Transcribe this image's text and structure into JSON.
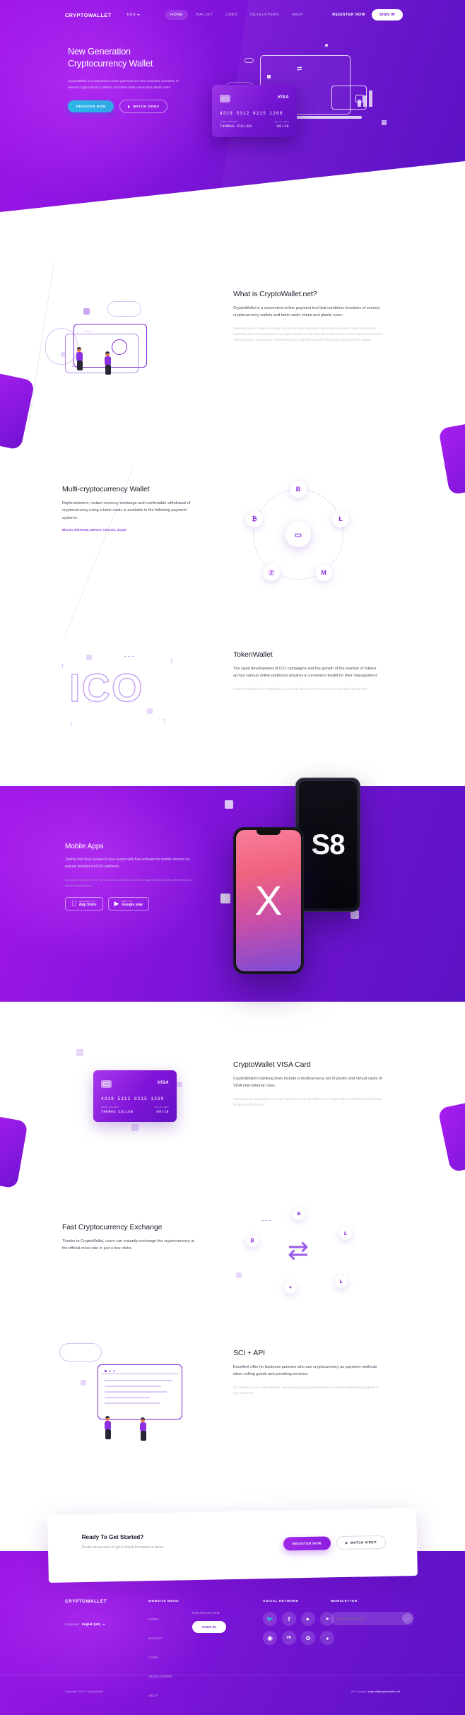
{
  "header": {
    "brand": "CRYPTOWALLET",
    "language": "ENG",
    "nav": [
      {
        "label": "HOME",
        "active": true
      },
      {
        "label": "WALLET",
        "active": false
      },
      {
        "label": "CARD",
        "active": false
      },
      {
        "label": "DEVELOPERS",
        "active": false
      },
      {
        "label": "HELP",
        "active": false
      }
    ],
    "register_label": "REGISTER NOW",
    "signin_label": "SIGN IN"
  },
  "hero": {
    "title_line1": "New Generation",
    "title_line2": "Cryptocurrency Wallet",
    "paragraph": "CryptoWallet is a convenient online payment tool that combines functions of several cryptocurrency wallets and bank cards virtual and plastic ones",
    "primary_button": "REGISTER NOW",
    "secondary_button": "WATCH VIDEO",
    "card": {
      "brand": "VISA",
      "number": "4319  5312  0215  1269",
      "holder_label": "CARD HOLDER",
      "holder_name": "THOMAS CULLEN",
      "expiry_label": "VALID THRU",
      "expiry": "09/18"
    }
  },
  "sections": {
    "what_is": {
      "title": "What is CryptoWallet.net?",
      "paragraph": "CryptoWallet is a convenient online payment tool that combines functions of several cryptocurrency wallets and bank cards virtual and plastic ones.",
      "fine_print": "Absolutely free of charge you can get an address of the interesting cryptocurrency, the list of which is constantly expanding with the development of our payment platform, and associate to your account a VISA international card for online payments, use at points of merchant service and withdrawal of funds through the global ATM network."
    },
    "multi_wallet": {
      "title": "Multi-cryptocurrency Wallet",
      "paragraph": "Replenishment, instant currency exchange and comfortable withdrawal of cryptocurrency using a bank cards is available in the following payment systems:",
      "coins_line": "Bitcoin, Ethereum, Monero, Litecoin, ZCash",
      "coin_symbols": [
        "₿",
        "Ł",
        "Ƀ",
        "M",
        "♦"
      ]
    },
    "token_wallet": {
      "title": "TokenWallet",
      "paragraph": "The rapid development of ICO campaigns and the growth of the number of tokens across various online platforms requires a convenient toolkit for their management.",
      "fine_print": "Using the capabilities of CryptoWallet, you can add any tokens into your account and easily operate them.",
      "art_word": "ICO"
    },
    "mobile_apps": {
      "title": "Mobile Apps",
      "paragraph": "Twenty-four hour access to your assets with free software for mobile devices on popular Android and iOS platforms.",
      "fine_print": "A complete replacement of the web version, which has the necessary functionality for performing any financial transactions.",
      "stores": [
        {
          "sub": "Download on the",
          "main": "App Store",
          "icon": "apple-icon"
        },
        {
          "sub": "GET IT ON",
          "main": "Google play",
          "icon": "google-play-icon"
        }
      ],
      "phone_x_label": "X",
      "phone_s8_label": "S8"
    },
    "visa_card": {
      "title": "CryptoWallet VISA Card",
      "paragraph": "CryptoWallet's banking tools include a multicurrency set of plastic and virtual cards of VISA international class.",
      "fine_print": "That allows you to instantly convert the cryptocurrency to pay online, use in shops outlet and withdraw funds through the global ATM network.",
      "card": {
        "brand": "VISA",
        "number": "4319  5312  0215  1269",
        "holder_label": "CARD HOLDER",
        "holder_name": "THOMAS CULLEN",
        "expiry_label": "VALID THRU",
        "expiry": "09/18"
      }
    },
    "exchange": {
      "title": "Fast Cryptocurrency Exchange",
      "paragraph": "Thanks to CryptoWallet, users can instantly exchange the cryptocurrency at the official cross rate in just a few clicks.",
      "coin_symbols": [
        "₿",
        "Ł",
        "Ƀ",
        "Ł",
        "♦"
      ]
    },
    "sci_api": {
      "title": "SCI + API",
      "paragraph": "Excellent offer for business partners who use cryptocurrency as payment methods when selling goods and providing services.",
      "fine_print": "SCI and API for your online websites. Fast processing of payments and low commission will bringing joy please to your customers!"
    }
  },
  "cta": {
    "title": "Ready To Get Started?",
    "subtitle": "Create an account or get in touch to request a demo",
    "register_label": "REGISTER NOW",
    "watch_label": "WATCH VIDEO"
  },
  "footer": {
    "brand": "CRYPTOWALLET",
    "language_label": "Language:",
    "language_value": "English (UK)",
    "menu_title": "WEBSITE MENU",
    "menu": [
      "HOME",
      "WALLET",
      "CARD",
      "DEVELOPERS",
      "HELP"
    ],
    "register_label": "REGISTER NOW",
    "signin_label": "SIGN IN",
    "social_title": "SOCIAL NETWORK",
    "social": [
      {
        "name": "twitter-icon",
        "glyph": "ᴠ"
      },
      {
        "name": "facebook-icon",
        "glyph": "f"
      },
      {
        "name": "youtube-icon",
        "glyph": "▶"
      },
      {
        "name": "telegram-icon",
        "glyph": "➤"
      },
      {
        "name": "github-icon",
        "glyph": "●"
      },
      {
        "name": "vk-icon",
        "glyph": "VK"
      },
      {
        "name": "weibo-icon",
        "glyph": "✿"
      },
      {
        "name": "reddit-icon",
        "glyph": "◑"
      }
    ],
    "newsletter_title": "NEWSLETTER",
    "newsletter_placeholder": "yourmail@gmail.com",
    "newsletter_button": "→",
    "copyright": "Copyright ©2017 CryptoWallet.",
    "support_label": "24\\7 support:",
    "support_email": "support@cryptowallet.net"
  },
  "colors": {
    "purple_dark": "#5d12c6",
    "purple_mid": "#8b14df",
    "purple_bright": "#a318e9",
    "accent_cyan": "#2bb8e8",
    "accent_violet": "#8b2fe0"
  }
}
